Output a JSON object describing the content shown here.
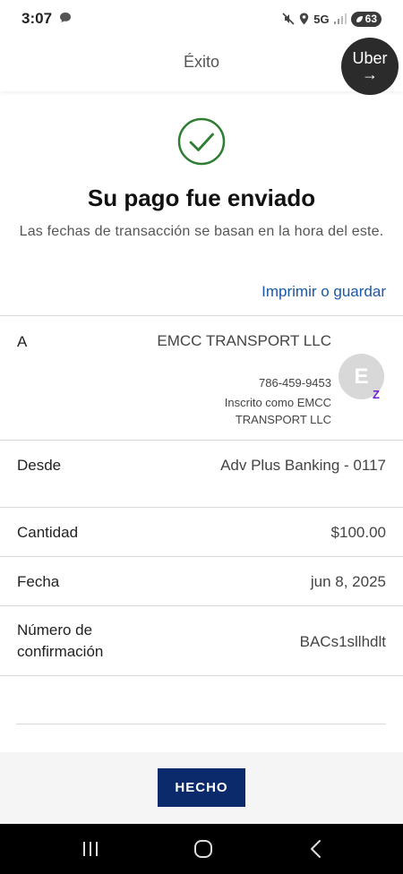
{
  "status_bar": {
    "time": "3:07",
    "network": "5G",
    "battery": "63",
    "icons": [
      "chat-icon",
      "mute-icon",
      "location-icon",
      "signal-icon",
      "battery-icon"
    ]
  },
  "header": {
    "title": "Éxito"
  },
  "uber_bubble": {
    "label": "Uber",
    "arrow": "→"
  },
  "confirmation": {
    "title": "Su pago fue enviado",
    "subtitle": "Las fechas de transacción se basan en la hora del este.",
    "print_link": "Imprimir o guardar"
  },
  "details": {
    "to": {
      "label": "A",
      "name": "EMCC TRANSPORT LLC",
      "phone": "786-459-9453",
      "enrolled": "Inscrito como EMCC TRANSPORT LLC",
      "avatar_initial": "E",
      "badge": "Z"
    },
    "from": {
      "label": "Desde",
      "value": "Adv Plus Banking - 0117"
    },
    "amount": {
      "label": "Cantidad",
      "value": "$100.00"
    },
    "date": {
      "label": "Fecha",
      "value": "jun 8, 2025"
    },
    "confirmation_number": {
      "label": "Número de confirmación",
      "value": "BACs1sllhdlt"
    }
  },
  "actions": {
    "done": "HECHO"
  },
  "colors": {
    "success_green": "#2e7d32",
    "link_blue": "#1a58a8",
    "button_navy": "#0a2a6b",
    "zelle_purple": "#6d1ed4"
  }
}
